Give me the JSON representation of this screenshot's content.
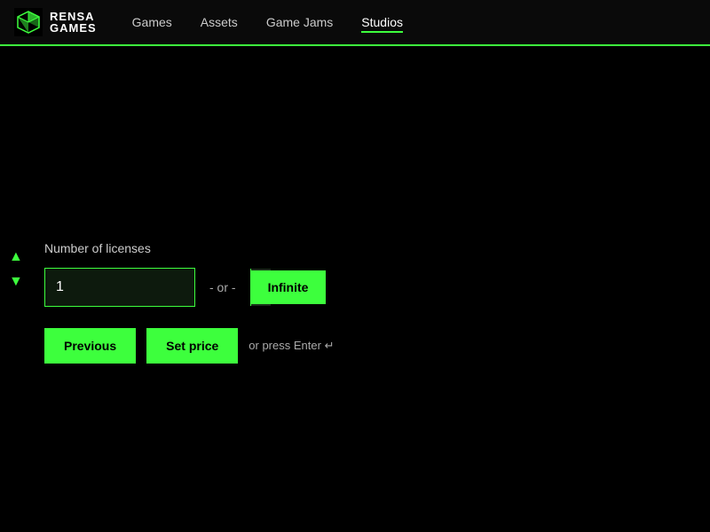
{
  "logo": {
    "line1": "RENSA",
    "line2": "GAMES"
  },
  "nav": {
    "items": [
      {
        "label": "Games",
        "active": false
      },
      {
        "label": "Assets",
        "active": false
      },
      {
        "label": "Game Jams",
        "active": false
      },
      {
        "label": "Studios",
        "active": true
      }
    ]
  },
  "main": {
    "label": "Number of licenses",
    "input_value": "1",
    "or_text": "- or -",
    "infinite_label": "Infinite",
    "previous_label": "Previous",
    "set_price_label": "Set price",
    "hint_text": "or press Enter"
  }
}
